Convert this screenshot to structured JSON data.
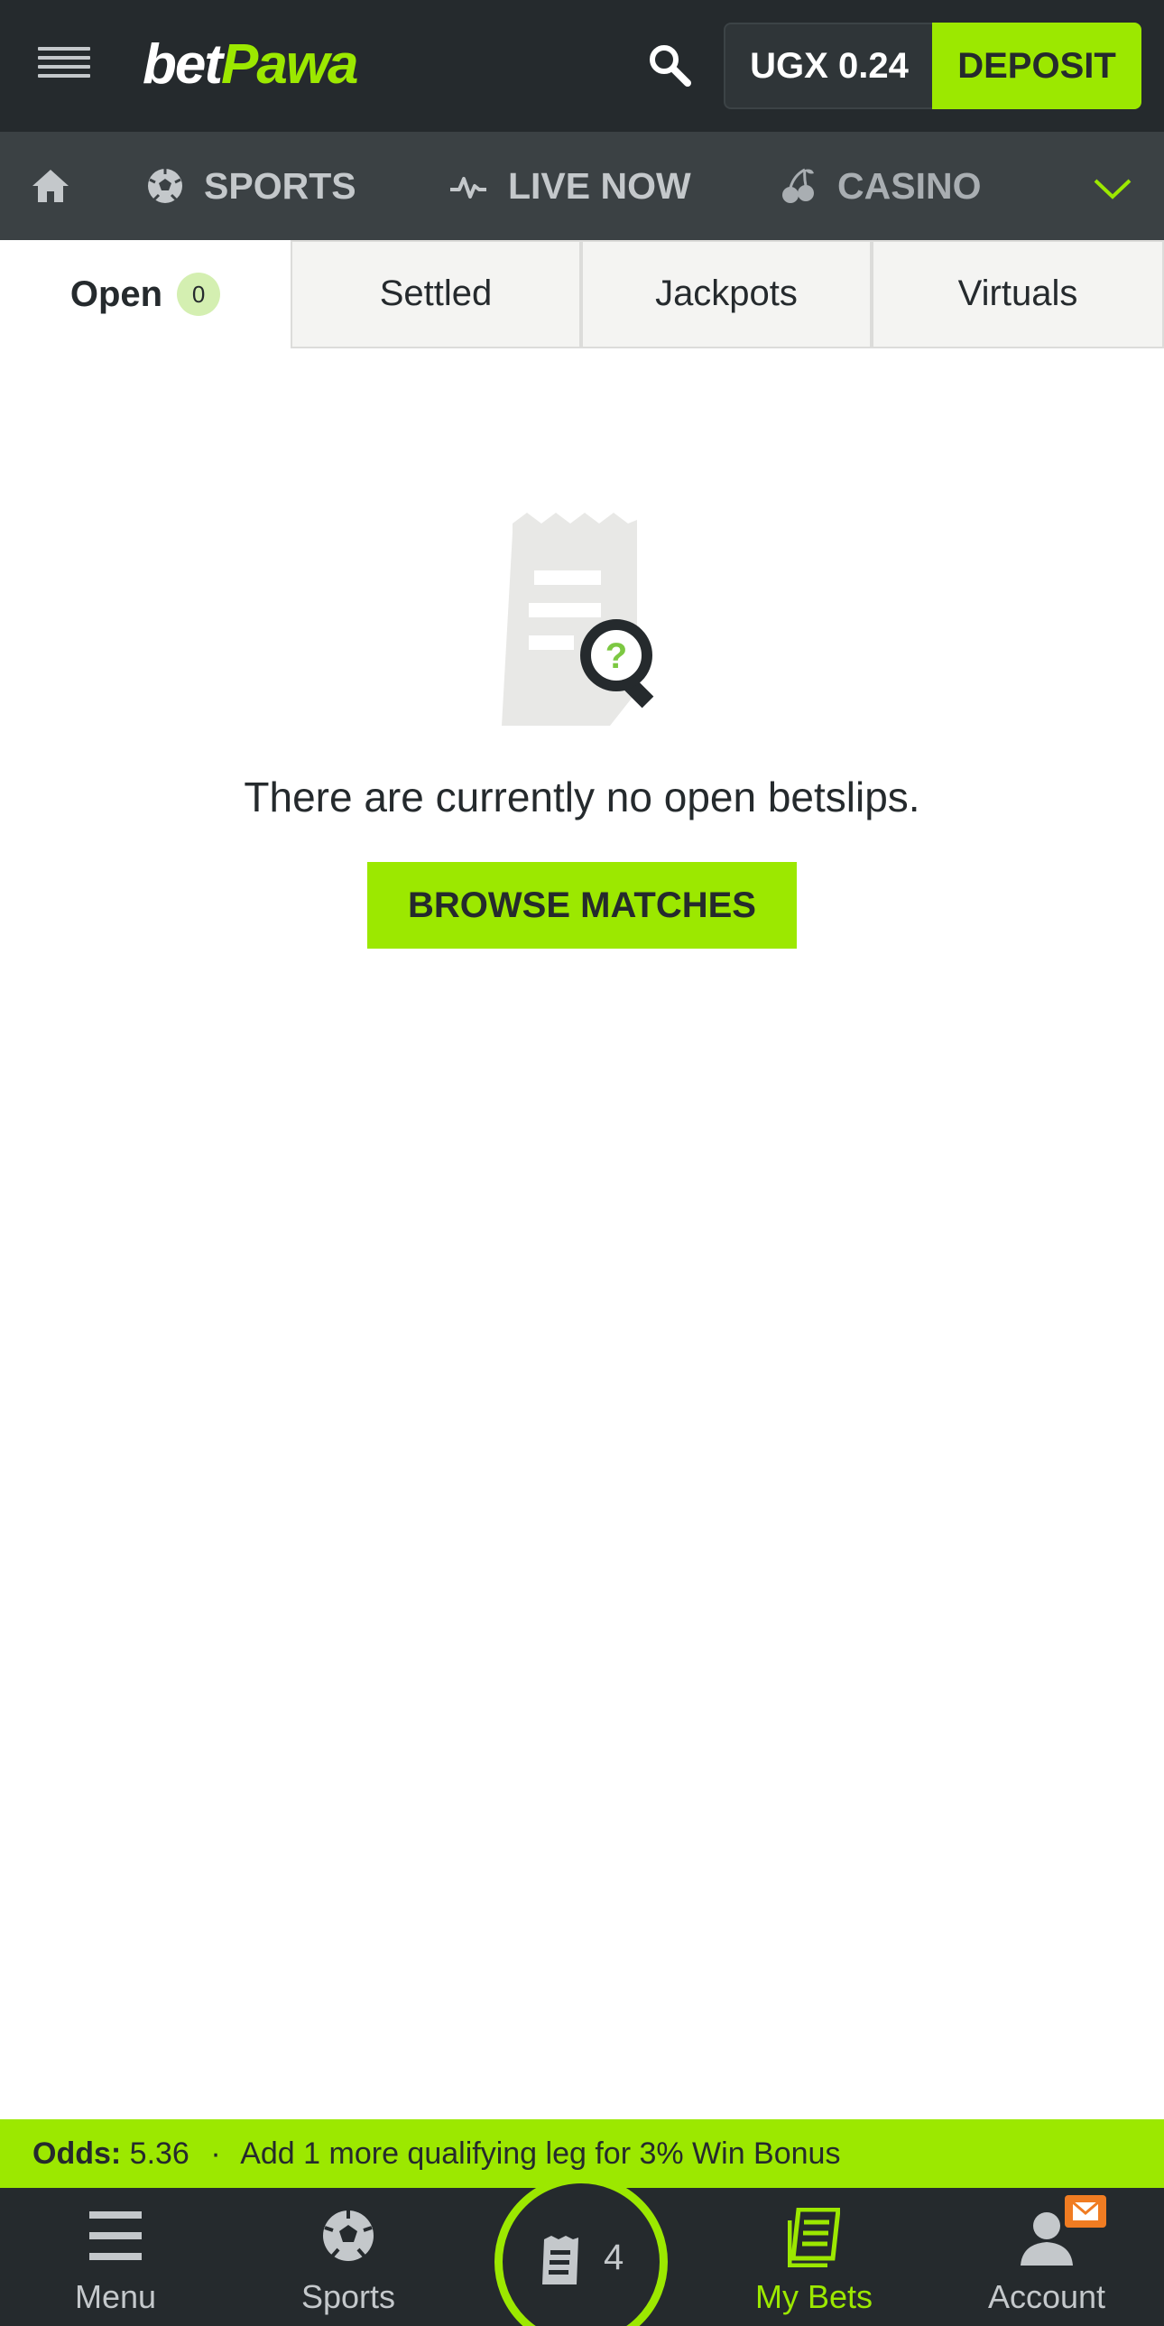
{
  "header": {
    "logo_bet": "bet",
    "logo_pawa": "Pawa",
    "balance": "UGX 0.24",
    "deposit_label": "DEPOSIT"
  },
  "nav": {
    "items": [
      {
        "label": "",
        "icon": "home-icon"
      },
      {
        "label": "SPORTS",
        "icon": "soccer-ball-icon"
      },
      {
        "label": "LIVE NOW",
        "icon": "pulse-icon"
      },
      {
        "label": "CASINO",
        "icon": "cherries-icon"
      }
    ],
    "more_icon": "chevron-down-icon"
  },
  "tabs": {
    "open_label": "Open",
    "open_count": "0",
    "settled_label": "Settled",
    "jackpots_label": "Jackpots",
    "virtuals_label": "Virtuals"
  },
  "empty_state": {
    "message": "There are currently no open betslips.",
    "button_label": "BROWSE MATCHES",
    "icon": "receipt-search-icon"
  },
  "bonus_bar": {
    "odds_label": "Odds:",
    "odds_value": "5.36",
    "separator": "·",
    "message": "Add 1 more qualifying leg for 3% Win Bonus"
  },
  "bottom_nav": {
    "menu_label": "Menu",
    "sports_label": "Sports",
    "betslip_count": "4",
    "mybets_label": "My Bets",
    "account_label": "Account"
  },
  "colors": {
    "brand_green": "#9ce800",
    "header_dark": "#252a2d",
    "nav_bar": "#3b4144",
    "mail_badge": "#f07c22"
  }
}
